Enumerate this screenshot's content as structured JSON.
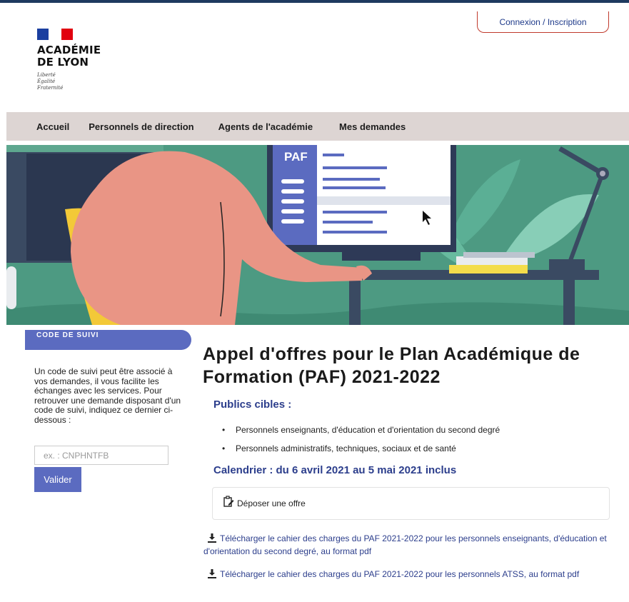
{
  "header": {
    "logo_name_line1": "ACADÉMIE",
    "logo_name_line2": "DE LYON",
    "motto": [
      "Liberté",
      "Égalité",
      "Fraternité"
    ],
    "login_label": "Connexion / Inscription"
  },
  "nav": {
    "items": [
      "Accueil",
      "Personnels de direction",
      "Agents de l'académie",
      "Mes demandes"
    ]
  },
  "banner": {
    "screen_label": "PAF",
    "icon": "illustration-person-at-computer"
  },
  "sidebar": {
    "tab_label": "CODE DE SUIVI",
    "description": "Un code de suivi peut être associé à vos demandes, il vous facilite les échanges avec les services. Pour retrouver une demande disposant d'un code de suivi, indiquez ce dernier ci-dessous :",
    "input_placeholder": "ex. : CNPHNTFB",
    "validate_label": "Valider"
  },
  "main": {
    "title": "Appel d'offres pour le Plan Académique de Formation (PAF) 2021-2022",
    "publics_heading": "Publics cibles :",
    "publics": [
      "Personnels enseignants, d'éducation et d'orientation du second degré",
      "Personnels administratifs, techniques, sociaux et de santé"
    ],
    "calendar_heading": "Calendrier : du 6 avril 2021 au 5 mai 2021 inclus",
    "offer_label": "Déposer une offre",
    "downloads": [
      "Télécharger le cahier des charges du PAF 2021-2022 pour les personnels enseignants, d'éducation et d'orientation du second degré, au format pdf",
      "Télécharger le cahier des charges du PAF 2021-2022 pour les personnels ATSS, au format pdf"
    ]
  },
  "colors": {
    "accent": "#5b6bc0",
    "link": "#2c3e8c",
    "nav_bg": "#ddd5d3",
    "banner_bg": "#4d9a82"
  }
}
